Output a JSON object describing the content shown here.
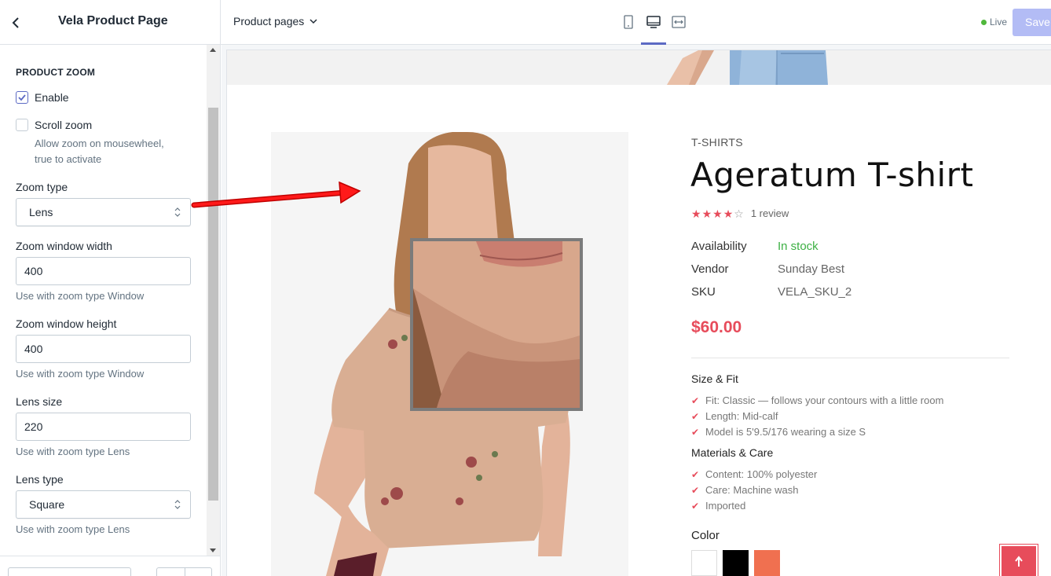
{
  "header": {
    "app_title": "Vela Product Page",
    "page_picker": "Product pages",
    "live_label": "Live",
    "save_label": "Save",
    "colors": {
      "accent": "#5c6ac4",
      "save_bg": "#b3bcf5",
      "live": "#50b83c"
    }
  },
  "panel": {
    "section_title": "PRODUCT ZOOM",
    "enable_label": "Enable",
    "enable_checked": true,
    "scroll_zoom_label": "Scroll zoom",
    "scroll_zoom_checked": false,
    "scroll_zoom_help_1": "Allow zoom on mousewheel,",
    "scroll_zoom_help_2": "true to activate",
    "zoom_type_label": "Zoom type",
    "zoom_type_value": "Lens",
    "zoom_window_width_label": "Zoom window width",
    "zoom_window_width_value": "400",
    "zoom_window_width_help": "Use with zoom type Window",
    "zoom_window_height_label": "Zoom window height",
    "zoom_window_height_value": "400",
    "zoom_window_height_help": "Use with zoom type Window",
    "lens_size_label": "Lens size",
    "lens_size_value": "220",
    "lens_size_help": "Use with zoom type Lens",
    "lens_type_label": "Lens type",
    "lens_type_value": "Square",
    "lens_type_help": "Use with zoom type Lens"
  },
  "product": {
    "category": "T-SHIRTS",
    "title": "Ageratum T-shirt",
    "rating": 4,
    "rating_max": 5,
    "reviews": "1 review",
    "availability_label": "Availability",
    "availability_value": "In stock",
    "vendor_label": "Vendor",
    "vendor_value": "Sunday Best",
    "sku_label": "SKU",
    "sku_value": "VELA_SKU_2",
    "price": "$60.00",
    "size_fit_title": "Size & Fit",
    "size_fit": [
      "Fit: Classic — follows your contours with a little room",
      "Length: Mid-calf",
      "Model is 5'9.5/176 wearing a size S"
    ],
    "materials_title": "Materials & Care",
    "materials": [
      "Content: 100% polyester",
      "Care: Machine wash",
      "Imported"
    ],
    "color_label": "Color",
    "swatches": [
      "#ffffff",
      "#000000",
      "#f07050"
    ],
    "price_color": "#e74c5b"
  }
}
